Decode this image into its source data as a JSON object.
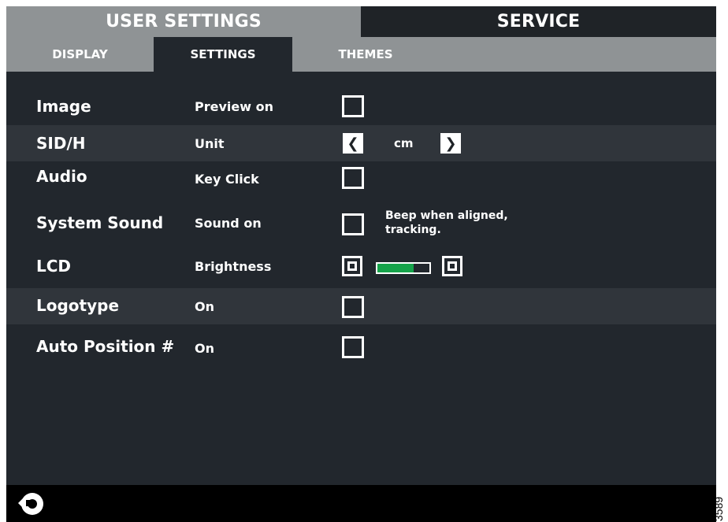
{
  "tabs": {
    "user_settings": "USER SETTINGS",
    "service": "SERVICE"
  },
  "subtabs": {
    "display": "DISPLAY",
    "settings": "SETTINGS",
    "themes": "THEMES"
  },
  "rows": {
    "image": {
      "label": "Image",
      "option": "Preview on",
      "checked": false
    },
    "sidh": {
      "label": "SID/H",
      "option": "Unit",
      "value": "cm"
    },
    "audio": {
      "label": "Audio",
      "option": "Key Click",
      "checked": false
    },
    "system_sound": {
      "label": "System Sound",
      "option": "Sound on",
      "checked": false,
      "note": "Beep when aligned, tracking."
    },
    "lcd": {
      "label": "LCD",
      "option": "Brightness",
      "level": 0.7
    },
    "logotype": {
      "label": "Logotype",
      "option": "On",
      "checked": false
    },
    "auto_position": {
      "label": "Auto Position #",
      "option": "On",
      "checked": false
    }
  },
  "figure_number": "3589",
  "colors": {
    "background": "#22272d",
    "tab_bar": "#8f9395",
    "shaded_row": "#30353b",
    "accent_separator": "#2c5d86",
    "brightness_fill": "#16a34a",
    "bottom_bar": "#000000"
  },
  "icons": {
    "back": "back-arrow-icon",
    "left": "chevron-left-icon",
    "right": "chevron-right-icon"
  }
}
